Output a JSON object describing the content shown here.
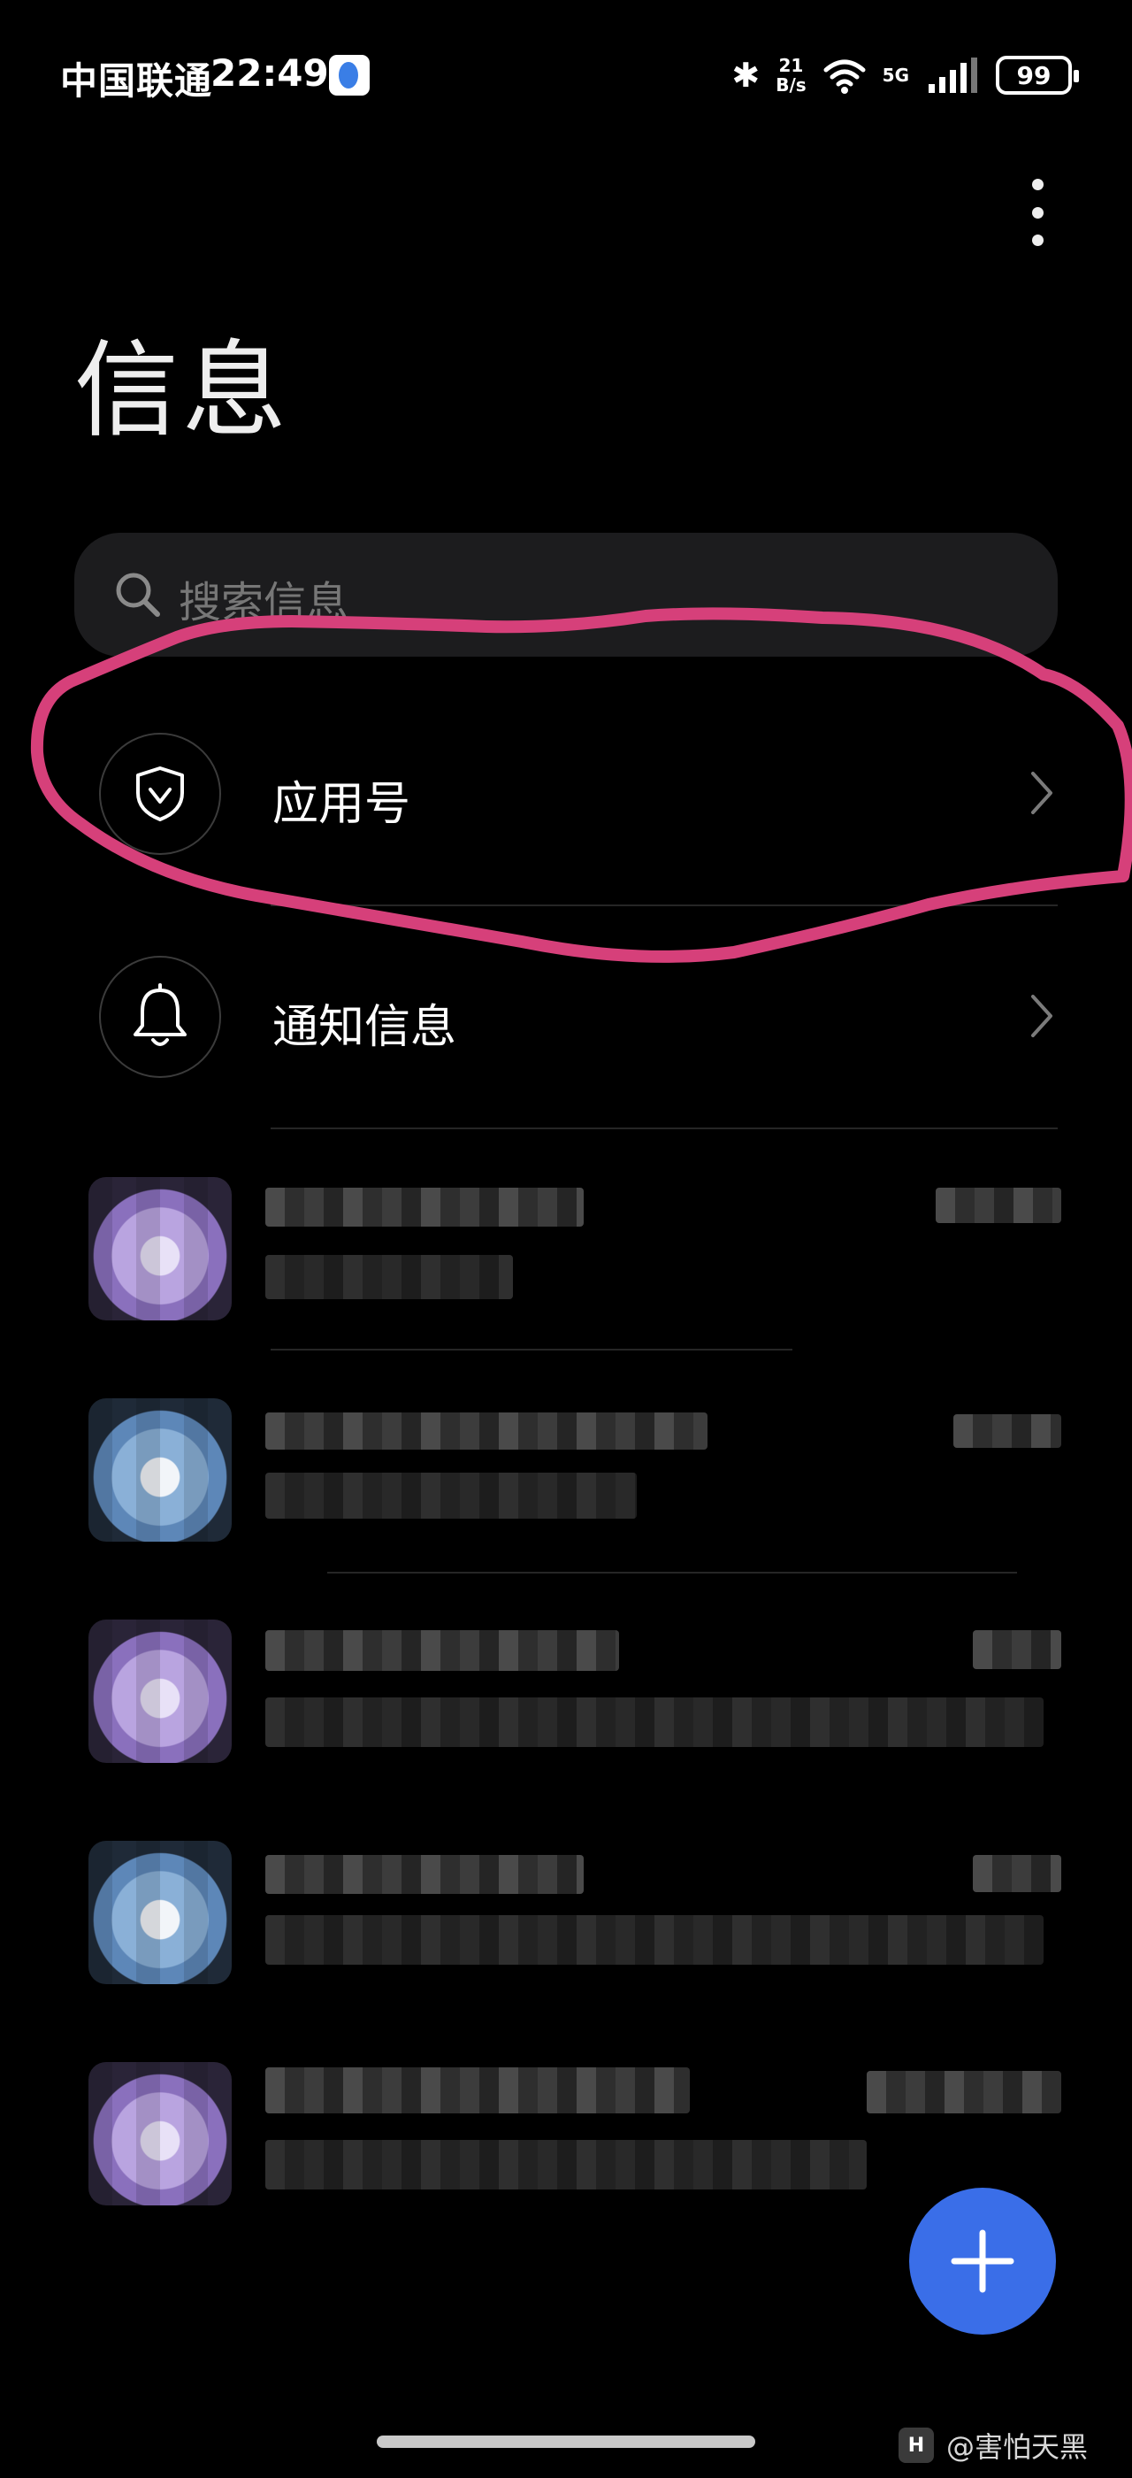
{
  "status_bar": {
    "carrier": "中国联通",
    "time": "22:49",
    "net_speed_top": "21",
    "net_speed_bottom": "B/s",
    "network": "5G",
    "battery": "99"
  },
  "header": {
    "title": "信息"
  },
  "search": {
    "placeholder": "搜索信息"
  },
  "entries": [
    {
      "label": "应用号",
      "icon": "shield-check-icon"
    },
    {
      "label": "通知信息",
      "icon": "bell-icon"
    }
  ],
  "conversations_redacted": [
    {
      "avatar_color": "purple"
    },
    {
      "avatar_color": "blue"
    },
    {
      "avatar_color": "purple"
    },
    {
      "avatar_color": "blue"
    },
    {
      "avatar_color": "purple"
    }
  ],
  "colors": {
    "accent": "#3a6ee8",
    "highlight_annotation": "#d6407a",
    "background": "#000000"
  },
  "watermark": {
    "logo_text": "H",
    "text": "@害怕天黑"
  }
}
